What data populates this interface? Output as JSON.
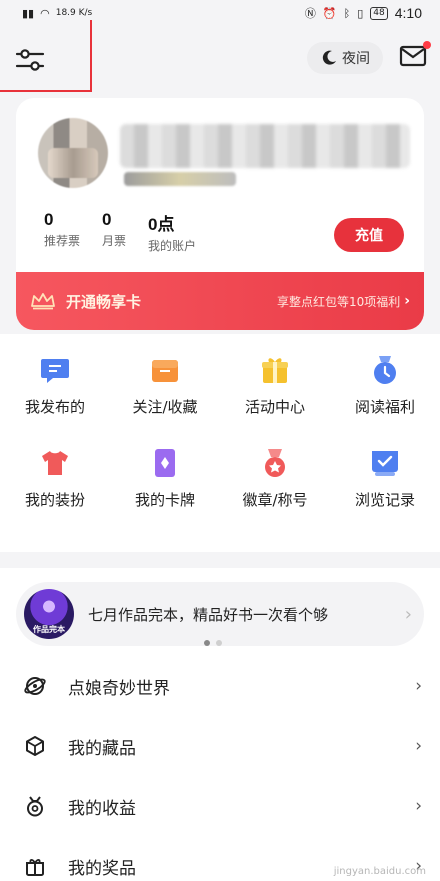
{
  "status_bar": {
    "net_speed": "18.9 K/s",
    "battery": "48",
    "time": "4:10"
  },
  "toolbar": {
    "night_label": "夜间"
  },
  "profile": {
    "stats": [
      {
        "value": "0",
        "label": "推荐票"
      },
      {
        "value": "0",
        "label": "月票"
      },
      {
        "value": "0点",
        "label": "我的账户"
      }
    ],
    "recharge_label": "充值",
    "vip": {
      "title": "开通畅享卡",
      "subtitle": "享整点红包等10项福利",
      "arrow": "›"
    }
  },
  "grid": {
    "items": [
      {
        "label": "我发布的",
        "icon": "message-icon",
        "color": "#4f7ff0"
      },
      {
        "label": "关注/收藏",
        "icon": "folder-icon",
        "color": "#f7923a"
      },
      {
        "label": "活动中心",
        "icon": "gift-icon",
        "color": "#f5c12e"
      },
      {
        "label": "阅读福利",
        "icon": "clock-badge-icon",
        "color": "#4f7ff0"
      },
      {
        "label": "我的装扮",
        "icon": "shirt-icon",
        "color": "#f05a5a"
      },
      {
        "label": "我的卡牌",
        "icon": "card-icon",
        "color": "#9b6bf0"
      },
      {
        "label": "徽章/称号",
        "icon": "medal-icon",
        "color": "#f05a5a"
      },
      {
        "label": "浏览记录",
        "icon": "history-icon",
        "color": "#4f7ff0"
      }
    ]
  },
  "banner": {
    "text": "七月作品完本，精品好书一次看个够",
    "image_caption": "作品完本",
    "arrow": "›"
  },
  "menu": {
    "items": [
      {
        "label": "点娘奇妙世界",
        "icon": "world-icon"
      },
      {
        "label": "我的藏品",
        "icon": "cube-icon"
      },
      {
        "label": "我的收益",
        "icon": "earnings-icon"
      },
      {
        "label": "我的奖品",
        "icon": "prize-icon"
      }
    ],
    "arrow": "›"
  },
  "watermark": "jingyan.baidu.com"
}
